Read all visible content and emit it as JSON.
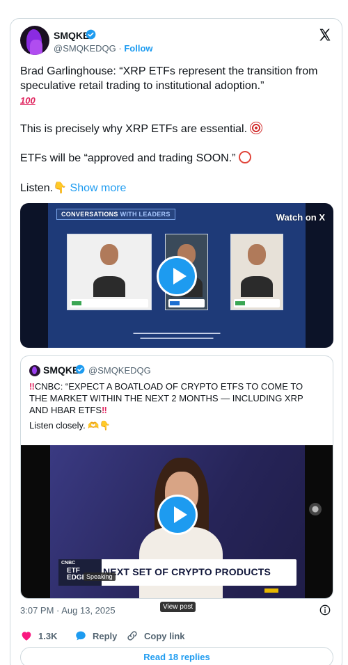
{
  "author": {
    "name": "SMQKE",
    "handle": "@SMQKEDQG",
    "separator": "·",
    "follow_label": "Follow"
  },
  "tweet": {
    "paragraph1": "Brad Garlinghouse: “XRP ETFs represent the transition from speculative retail trading to institutional adoption.”",
    "paragraph1_emoji": "100",
    "paragraph2": "This is precisely why XRP ETFs are essential.",
    "paragraph3": "ETFs will be “approved and trading SOON.”",
    "paragraph4": "Listen.",
    "show_more_label": "Show more"
  },
  "video1": {
    "watch_label": "Watch on X",
    "banner_part1": "CONVERSATIONS",
    "banner_part2": "WITH LEADERS"
  },
  "quoted_tweet": {
    "name": "SMQKE",
    "handle": "@SMQKEDQG",
    "marker": "‼",
    "text": "CNBC: “EXPECT A BOATLOAD OF CRYPTO ETFS TO COME TO THE MARKET WITHIN THE NEXT 2 MONTHS — INCLUDING XRP AND HBAR ETFS",
    "text2": "Listen closely.",
    "video": {
      "network": "CNBC",
      "show_line1": "ETF",
      "show_line2": "EDGE",
      "headline": "NEXT SET OF CRYPTO PRODUCTS",
      "speaking_label": "Speaking"
    }
  },
  "footer": {
    "timestamp": "3:07 PM · Aug 13, 2025",
    "view_post_label": "View post",
    "likes": "1.3K",
    "reply_label": "Reply",
    "copy_link_label": "Copy link",
    "read_replies_label": "Read 18 replies"
  },
  "colors": {
    "accent": "#1d9bf0",
    "like": "#f91880",
    "text": "#0f1419",
    "muted": "#536471"
  }
}
